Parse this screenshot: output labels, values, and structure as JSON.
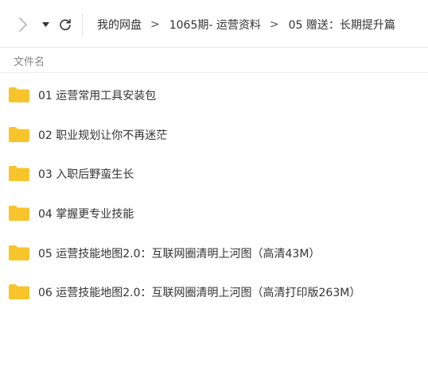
{
  "toolbar": {
    "forward_icon": "chevron-right-icon",
    "dropdown_icon": "caret-down-icon",
    "refresh_icon": "refresh-icon"
  },
  "breadcrumb": {
    "items": [
      "我的网盘",
      "1065期- 运营资料",
      "05 赠送：长期提升篇"
    ],
    "separator": ">"
  },
  "list_header": {
    "name_column": "文件名"
  },
  "folder_color": "#f7c52b",
  "files": [
    {
      "name": "01 运营常用工具安装包"
    },
    {
      "name": "02 职业规划让你不再迷茫"
    },
    {
      "name": "03 入职后野蛮生长"
    },
    {
      "name": "04 掌握更专业技能"
    },
    {
      "name": "05 运营技能地图2.0：互联网圈清明上河图（高清43M）"
    },
    {
      "name": "06 运营技能地图2.0：互联网圈清明上河图（高清打印版263M）"
    }
  ]
}
